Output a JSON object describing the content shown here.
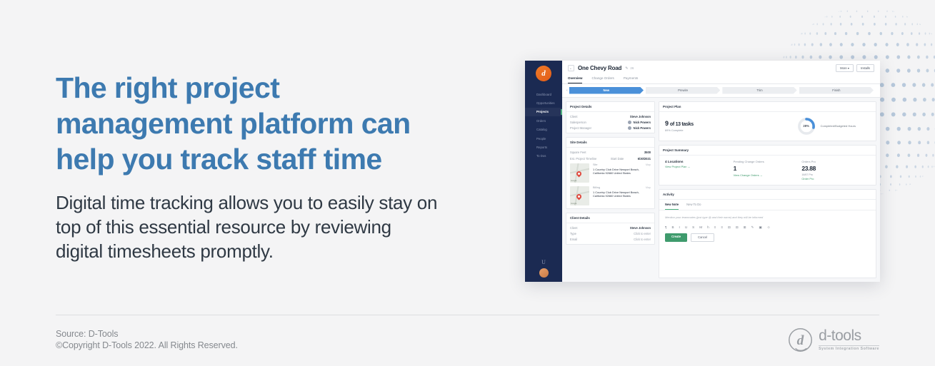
{
  "headline": "The right project\nmanagement platform can\nhelp you track staff time",
  "subcopy": "Digital time tracking allows you to easily stay on\ntop of this essential resource by reviewing\ndigital timesheets promptly.",
  "footer": {
    "source": "Source: D-Tools",
    "copyright": "©Copyright D-Tools 2022. All Rights Reserved."
  },
  "logo": {
    "mark": "d",
    "name": "d-tools",
    "tagline": "System Integration Software"
  },
  "colors": {
    "headline": "#3d7ab0",
    "body": "#2f3944",
    "background": "#f4f4f5",
    "footer_text": "#85898e",
    "accent_green": "#3f9b6d",
    "accent_blue": "#4a90d9",
    "sidebar": "#1b2a52",
    "brand_orange": "#e8701f"
  },
  "app": {
    "sidebar": {
      "logo_letter": "d",
      "items": [
        {
          "label": "Dashboard",
          "icon": "dashboard-icon",
          "active": false
        },
        {
          "label": "Opportunities",
          "icon": "opportunities-icon",
          "active": false
        },
        {
          "label": "Projects",
          "icon": "projects-icon",
          "active": true
        },
        {
          "label": "Orders",
          "icon": "orders-icon",
          "active": false
        },
        {
          "label": "Catalog",
          "icon": "catalog-icon",
          "active": false
        },
        {
          "label": "People",
          "icon": "people-icon",
          "active": false
        },
        {
          "label": "Reports",
          "icon": "reports-icon",
          "active": false
        },
        {
          "label": "To Dos",
          "icon": "todos-icon",
          "active": false
        }
      ],
      "footer_mark": "U"
    },
    "header": {
      "back_icon": "←",
      "title": "One Chevy Road",
      "edit_icon": "✎",
      "project_id": "26",
      "buttons": [
        {
          "label": "More ▾",
          "name": "more-button"
        },
        {
          "label": "Installs",
          "name": "installs-button"
        }
      ],
      "tabs": [
        {
          "label": "Overview",
          "active": true
        },
        {
          "label": "Change Orders",
          "active": false
        },
        {
          "label": "Payments",
          "active": false
        }
      ]
    },
    "stages": [
      {
        "label": "New",
        "active": true
      },
      {
        "label": "Prewire",
        "active": false
      },
      {
        "label": "Trim",
        "active": false
      },
      {
        "label": "Finish",
        "active": false
      }
    ],
    "project_details": {
      "title": "Project Details",
      "rows": [
        {
          "label": "Client",
          "value": "Steve Johnson",
          "avatar": false
        },
        {
          "label": "Salesperson",
          "value": "Nick Powers",
          "avatar": true
        },
        {
          "label": "Project Manager",
          "value": "Nick Powers",
          "avatar": true
        }
      ]
    },
    "site_details": {
      "title": "Site Details",
      "rows": [
        {
          "label": "Square Feet",
          "value": "3500"
        }
      ],
      "timeline_label": "Est. Project Timeline",
      "start_date_label": "Start Date",
      "start_date_value": "6/30/2021",
      "addresses": [
        {
          "kind": "Site",
          "tag": "Map",
          "text": "1 Country Club Drive Newport Beach, California 92660 United States",
          "map_credit": "Google"
        },
        {
          "kind": "Billing",
          "tag": "Map",
          "text": "1 Country Club Drive Newport Beach, California 92660 United States",
          "map_credit": "Google"
        }
      ]
    },
    "client_details": {
      "title": "Client Details",
      "rows": [
        {
          "label": "Client",
          "value": "Steve Johnson",
          "muted": false
        },
        {
          "label": "Type",
          "value": "Click to enter",
          "muted": true
        },
        {
          "label": "Email",
          "value": "Click to enter",
          "muted": true
        }
      ]
    },
    "project_plan": {
      "title": "Project Plan",
      "tasks_done": "9",
      "tasks_text": "of 13 tasks",
      "complete_label": "69% Complete",
      "donut_label": "Completed/Budgeted Hours",
      "donut_percent": "28%",
      "donut_value": 28
    },
    "project_summary": {
      "title": "Project Summary",
      "locations_value": "4 Locations",
      "locations_link": "View Project Plan →",
      "change_orders_label": "Pending Change Orders",
      "change_orders_value": "1",
      "change_orders_link": "View Change Orders →",
      "orders_label": "Orders Pro",
      "orders_value": "23.88",
      "orders_sub": "16/67 Pro",
      "orders_link": "Order Pro"
    },
    "activity": {
      "title": "Activity",
      "tabs": [
        {
          "label": "New Note",
          "active": true
        },
        {
          "label": "New To Do",
          "active": false
        }
      ],
      "placeholder": "Mention your teammates (just type @ and their name) and they will be informed",
      "toolbar_icons": [
        "paragraph-icon",
        "bold-icon",
        "italic-icon",
        "underline-icon",
        "strikethrough-icon",
        "highlight-icon",
        "list-bullet-icon",
        "align-left-icon",
        "align-center-icon",
        "indent-icon",
        "outdent-icon",
        "quote-icon",
        "link-icon",
        "image-icon",
        "emoji-icon"
      ],
      "toolbar_glyphs": [
        "¶",
        "B",
        "I",
        "U",
        "S",
        "M",
        "h",
        "≡",
        "≡",
        "⊟",
        "⊟",
        "⊞",
        "✎",
        "▣",
        "☺"
      ],
      "create_label": "Create",
      "cancel_label": "Cancel"
    }
  }
}
